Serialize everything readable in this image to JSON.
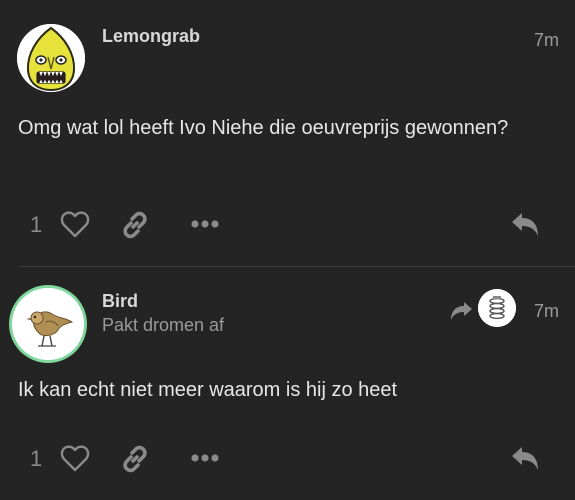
{
  "posts": [
    {
      "username": "Lemongrab",
      "time": "7m",
      "content": "Omg wat lol heeft Ivo Niehe die oeuvreprijs gewonnen?",
      "like_count": "1",
      "avatar": "lemongrab-avatar-icon"
    },
    {
      "username": "Bird",
      "user_title": "Pakt dromen af",
      "time": "7m",
      "content": "Ik kan echt niet meer waarom is hij zo heet",
      "like_count": "1",
      "avatar": "bird-avatar-icon",
      "reply_to_avatar": "reply-to-user-avatar-icon"
    }
  ],
  "colors": {
    "background": "#242424",
    "text": "#e6e6e6",
    "muted": "#9a9a9a",
    "icon": "#8a8a8a",
    "flair_ring": "#7fd79b"
  }
}
